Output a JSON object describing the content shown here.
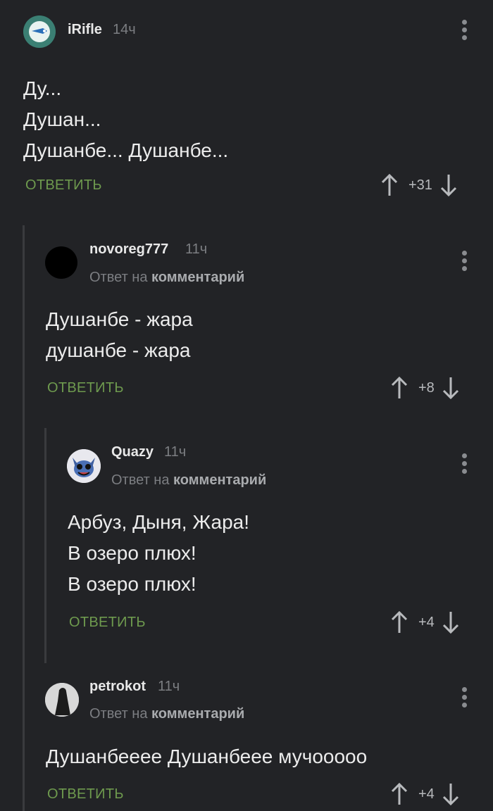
{
  "comments": [
    {
      "username": "iRifle",
      "time": "14ч",
      "reply_to_prefix": "",
      "reply_to_target": "",
      "lines": [
        "Ду...",
        "Душан...",
        "Душанбе... Душанбе..."
      ],
      "reply_label": "ОТВЕТИТЬ",
      "score": "+31"
    },
    {
      "username": "novoreg777",
      "time": "11ч",
      "reply_to_prefix": "Ответ на",
      "reply_to_target": "комментарий",
      "lines": [
        "Душанбе - жара",
        "душанбе - жара"
      ],
      "reply_label": "ОТВЕТИТЬ",
      "score": "+8"
    },
    {
      "username": "Quazy",
      "time": "11ч",
      "reply_to_prefix": "Ответ на",
      "reply_to_target": "комментарий",
      "lines": [
        "Арбуз, Дыня, Жара!",
        "В озеро плюх!",
        "В озеро плюх!"
      ],
      "reply_label": "ОТВЕТИТЬ",
      "score": "+4"
    },
    {
      "username": "petrokot",
      "time": "11ч",
      "reply_to_prefix": "Ответ на",
      "reply_to_target": "комментарий",
      "lines": [
        "Душанбееее Душанбеее мучооооо"
      ],
      "reply_label": "ОТВЕТИТЬ",
      "score": "+4"
    }
  ],
  "colors": {
    "background": "#222326",
    "reply_green": "#6e9a4e",
    "thread_line": "#3a3b3e"
  }
}
